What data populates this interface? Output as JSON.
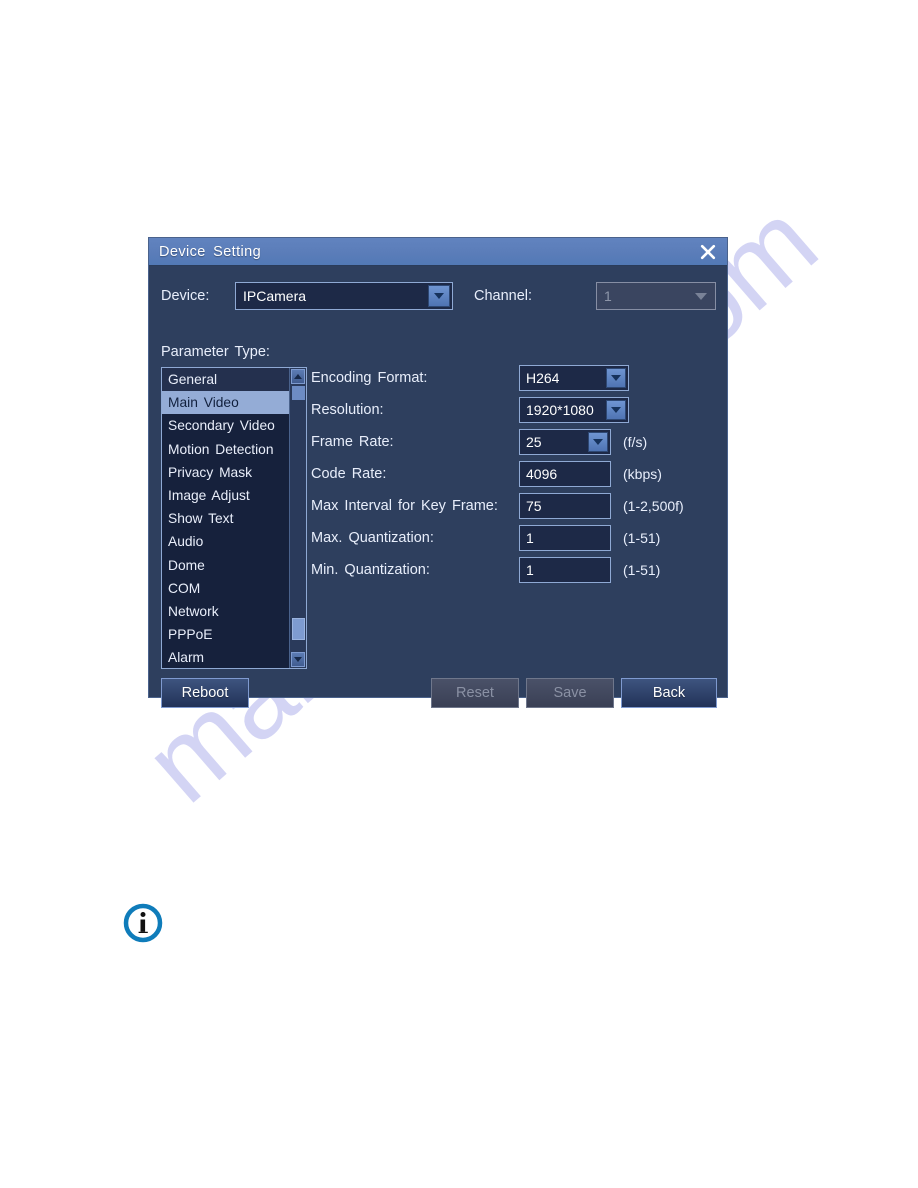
{
  "watermark": {
    "text": "manualshive.com"
  },
  "dialog": {
    "title": "Device  Setting",
    "close_icon": "close-icon",
    "device": {
      "label": "Device:",
      "value": "IPCamera"
    },
    "channel": {
      "label": "Channel:",
      "value": "1",
      "disabled": true
    },
    "parameter_type": {
      "label": "Parameter  Type:",
      "items": [
        {
          "label": "General",
          "selected": false
        },
        {
          "label": "Main  Video",
          "selected": true
        },
        {
          "label": "Secondary  Video",
          "selected": false
        },
        {
          "label": "Motion  Detection",
          "selected": false
        },
        {
          "label": "Privacy  Mask",
          "selected": false
        },
        {
          "label": "Image  Adjust",
          "selected": false
        },
        {
          "label": "Show  Text",
          "selected": false
        },
        {
          "label": "Audio",
          "selected": false
        },
        {
          "label": "Dome",
          "selected": false
        },
        {
          "label": "COM",
          "selected": false
        },
        {
          "label": "Network",
          "selected": false
        },
        {
          "label": "PPPoE",
          "selected": false
        },
        {
          "label": "Alarm",
          "selected": false
        }
      ],
      "scroll_up_icon": "chevron-up-icon",
      "scroll_down_icon": "chevron-down-icon"
    },
    "form": {
      "encoding_format": {
        "label": "Encoding  Format:",
        "value": "H264",
        "unit": ""
      },
      "resolution": {
        "label": "Resolution:",
        "value": "1920*1080",
        "unit": ""
      },
      "frame_rate": {
        "label": "Frame  Rate:",
        "value": "25",
        "unit": "(f/s)"
      },
      "code_rate": {
        "label": "Code  Rate:",
        "value": "4096",
        "unit": "(kbps)"
      },
      "max_interval": {
        "label": "Max  Interval  for  Key  Frame:",
        "value": "75",
        "unit": "(1-2,500f)"
      },
      "max_quant": {
        "label": "Max.  Quantization:",
        "value": "1",
        "unit": "(1-51)"
      },
      "min_quant": {
        "label": "Min.  Quantization:",
        "value": "1",
        "unit": "(1-51)"
      }
    },
    "buttons": {
      "reboot": "Reboot",
      "reset": "Reset",
      "save": "Save",
      "back": "Back"
    }
  },
  "note": {
    "info_icon": "info-icon"
  },
  "colors": {
    "titlebar": "#5b7db9",
    "dialog_bg": "#2e3f5e",
    "input_bg": "#1d2947",
    "input_border": "#8fa9d4",
    "list_bg": "#16213c",
    "list_selected": "#94acd6",
    "text": "#e8eefb",
    "disabled_text": "#8a91a4",
    "info_blue": "#0f7cba",
    "watermark": "#b9bbee"
  }
}
